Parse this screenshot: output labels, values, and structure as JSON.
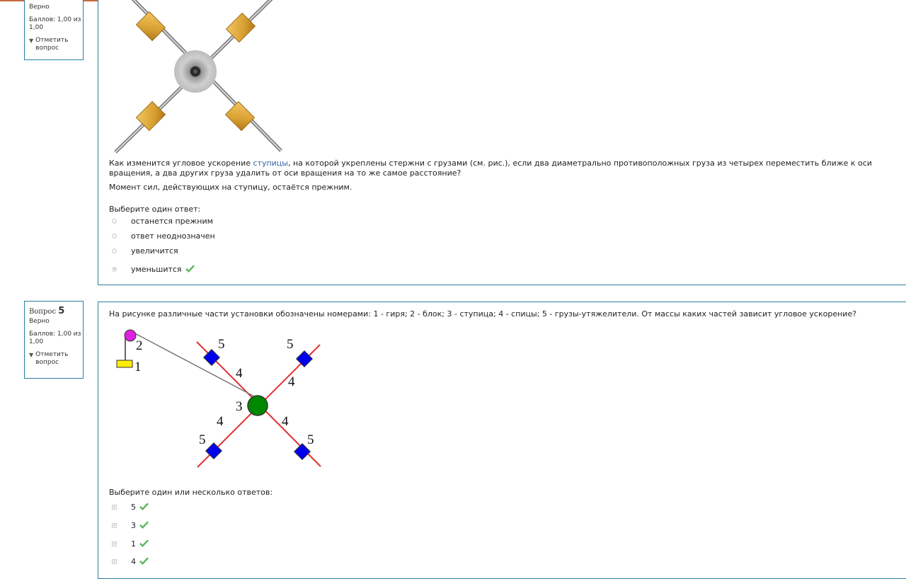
{
  "colors": {
    "border": "#2b7fa1",
    "tick": "#5cb85c",
    "top_rule": "#c46a3f",
    "link": "#3a63a8"
  },
  "q4": {
    "status": "Верно",
    "grade": "Баллов: 1,00 из 1,00",
    "flag_label": "Отметить вопрос",
    "text_before_link": "Как изменится угловое ускорение ",
    "link_text": "ступицы",
    "text_after_link": ", на которой укреплены стержни с грузами (см. рис.), если два диаметрально противоположных груза из четырех переместить ближе к оси вращения, а два других груза удалить от оси вращения на то же самое расстояние?",
    "text_second": "Момент сил, действующих на ступицу, остаётся прежним.",
    "prompt": "Выберите один ответ:",
    "options": [
      {
        "label": "останется прежним",
        "selected": false,
        "correct": false
      },
      {
        "label": "ответ неоднозначен",
        "selected": false,
        "correct": false
      },
      {
        "label": "увеличится",
        "selected": false,
        "correct": false
      },
      {
        "label": "уменьшится",
        "selected": true,
        "correct": true
      }
    ]
  },
  "q5": {
    "qno_label": "Вопрос",
    "qno_number": "5",
    "status": "Верно",
    "grade": "Баллов: 1,00 из 1,00",
    "flag_label": "Отметить вопрос",
    "text": "На рисунке различные части установки обозначены  номерами: 1 - гиря; 2 - блок; 3 - ступица; 4 - спицы; 5 - грузы-утяжелители. От массы каких частей зависит угловое ускорение?",
    "figure_labels": {
      "weight": "1",
      "pulley": "2",
      "hub": "3",
      "spoke": "4",
      "mass": "5"
    },
    "prompt": "Выберите один или несколько ответов:",
    "options": [
      {
        "label": "5",
        "checked": true,
        "correct": true
      },
      {
        "label": "3",
        "checked": true,
        "correct": true
      },
      {
        "label": "1",
        "checked": true,
        "correct": true
      },
      {
        "label": "4",
        "checked": true,
        "correct": true
      }
    ]
  }
}
